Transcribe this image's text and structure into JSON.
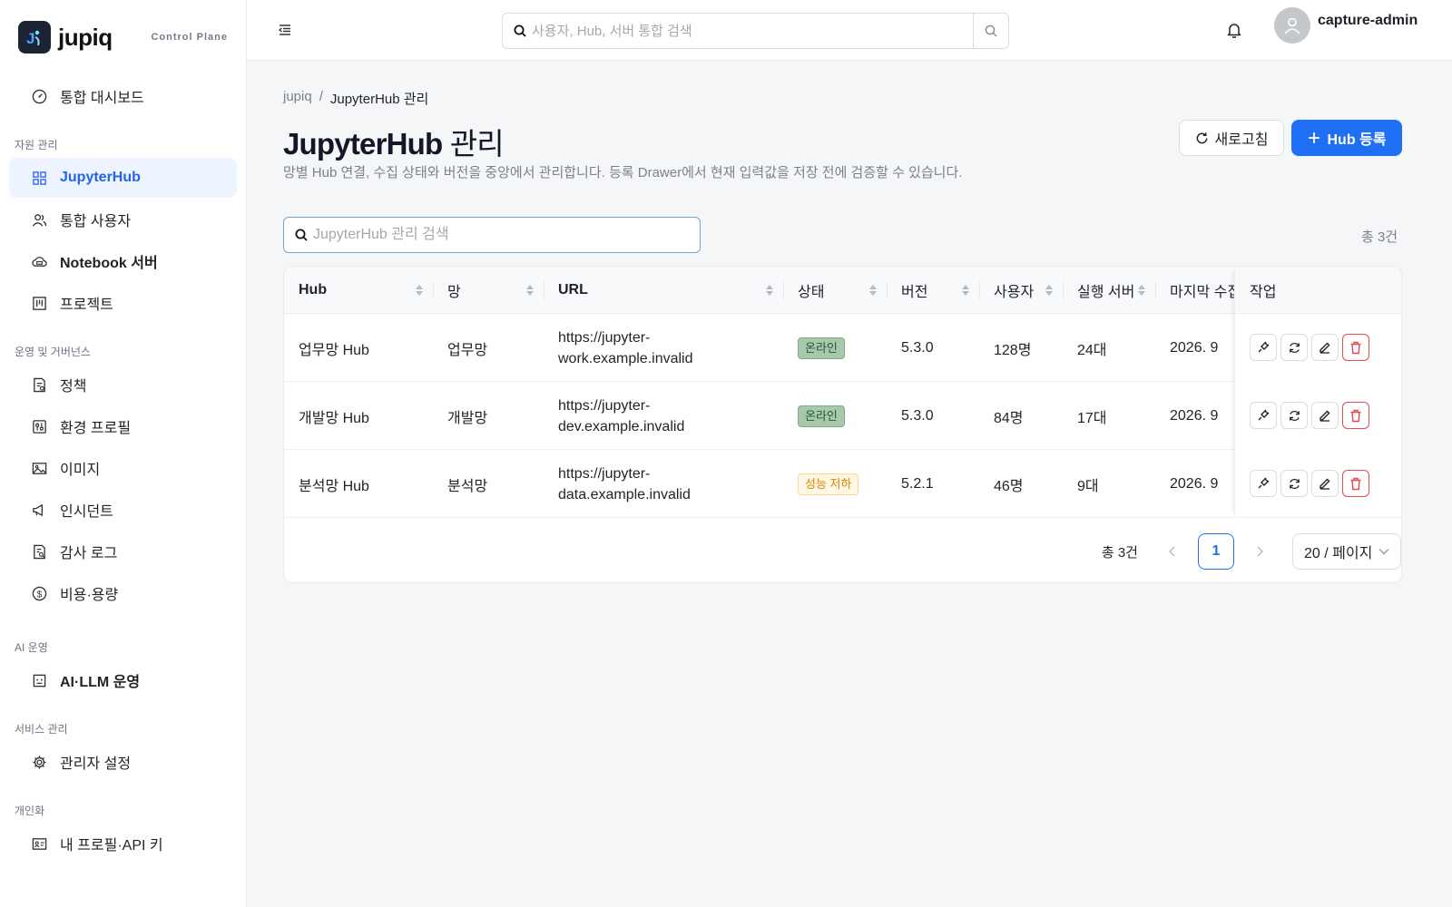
{
  "brand": {
    "name": "jupiq",
    "tag": "Control Plane"
  },
  "sidebar": {
    "dashboard": "통합 대시보드",
    "sections": {
      "resources": "자원 관리",
      "ops": "운영 및 거버넌스",
      "ai": "AI 운영",
      "service": "서비스 관리",
      "personal": "개인화"
    },
    "items": {
      "jupyterhub": "JupyterHub",
      "users": "통합 사용자",
      "notebook": "Notebook 서버",
      "projects": "프로젝트",
      "policy": "정책",
      "env_profile": "환경 프로필",
      "images": "이미지",
      "incidents": "인시던트",
      "audit": "감사 로그",
      "cost": "비용·용량",
      "ai_llm": "AI·LLM 운영",
      "admin": "관리자 설정",
      "profile": "내 프로필·API 키"
    }
  },
  "topbar": {
    "search_placeholder": "사용자, Hub, 서버 통합 검색",
    "username": "capture-admin"
  },
  "breadcrumb": {
    "root": "jupiq",
    "sep": "/",
    "current": "JupyterHub 관리"
  },
  "page": {
    "title_bold": "JupyterHub",
    "title_light": "관리",
    "description": "망별 Hub 연결, 수집 상태와 버전을 중앙에서 관리합니다. 등록 Drawer에서 현재 입력값을 저장 전에 검증할 수 있습니다.",
    "refresh_label": "새로고침",
    "add_label": "Hub 등록",
    "table_search_placeholder": "JupyterHub 관리 검색",
    "total_label": "총 3건"
  },
  "table": {
    "columns": {
      "hub": "Hub",
      "network": "망",
      "url": "URL",
      "status": "상태",
      "version": "버전",
      "users": "사용자",
      "servers": "실행 서버",
      "last": "마지막 수집",
      "actions": "작업"
    },
    "rows": [
      {
        "hub": "업무망 Hub",
        "network": "업무망",
        "url": "https://jupyter-work.example.invalid",
        "status": "온라인",
        "version": "5.3.0",
        "users": "128명",
        "servers": "24대",
        "last": "2026. 9"
      },
      {
        "hub": "개발망 Hub",
        "network": "개발망",
        "url": "https://jupyter-dev.example.invalid",
        "status": "온라인",
        "version": "5.3.0",
        "users": "84명",
        "servers": "17대",
        "last": "2026. 9"
      },
      {
        "hub": "분석망 Hub",
        "network": "분석망",
        "url": "https://jupyter-data.example.invalid",
        "status": "성능 저하",
        "version": "5.2.1",
        "users": "46명",
        "servers": "9대",
        "last": "2026. 9"
      }
    ]
  },
  "pagination": {
    "total": "총 3건",
    "current_page": "1",
    "page_size": "20 / 페이지"
  },
  "colors": {
    "accent": "#1f6ff5",
    "online": "#a9c7ab",
    "warn": "#d48806",
    "danger": "#e5484d"
  }
}
